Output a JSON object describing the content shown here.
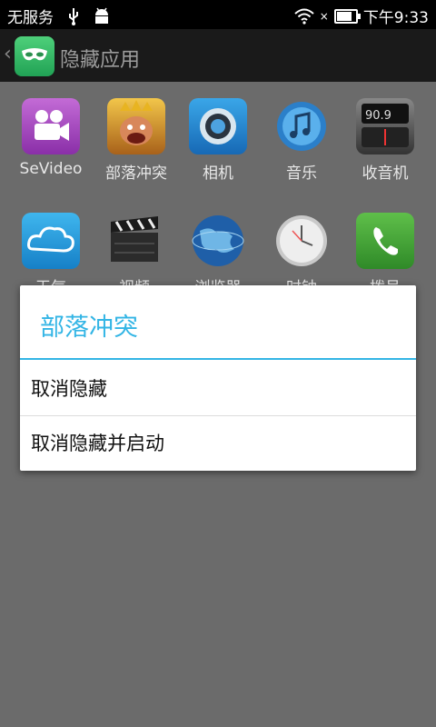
{
  "status_bar": {
    "carrier": "无服务",
    "time": "下午9:33",
    "icons": [
      "usb-icon",
      "android-icon",
      "wifi-icon",
      "no-signal-icon",
      "battery-icon"
    ],
    "battery_level_pct": 80
  },
  "action_bar": {
    "title": "隐藏应用",
    "icon": "mask-icon"
  },
  "apps": [
    {
      "label": "SeVideo",
      "icon": "video-camera-icon"
    },
    {
      "label": "部落冲突",
      "icon": "clash-of-clans-icon"
    },
    {
      "label": "相机",
      "icon": "camera-icon"
    },
    {
      "label": "音乐",
      "icon": "music-note-icon"
    },
    {
      "label": "收音机",
      "icon": "radio-icon"
    },
    {
      "label": "天气",
      "icon": "cloud-icon"
    },
    {
      "label": "视频",
      "icon": "clapperboard-icon"
    },
    {
      "label": "浏览器",
      "icon": "globe-icon"
    },
    {
      "label": "时钟",
      "icon": "clock-icon"
    },
    {
      "label": "拨号",
      "icon": "phone-icon"
    }
  ],
  "dialog": {
    "title": "部落冲突",
    "items": [
      "取消隐藏",
      "取消隐藏并启动"
    ]
  },
  "colors": {
    "accent": "#33b5e5",
    "scrim": "#6b6b6b"
  }
}
